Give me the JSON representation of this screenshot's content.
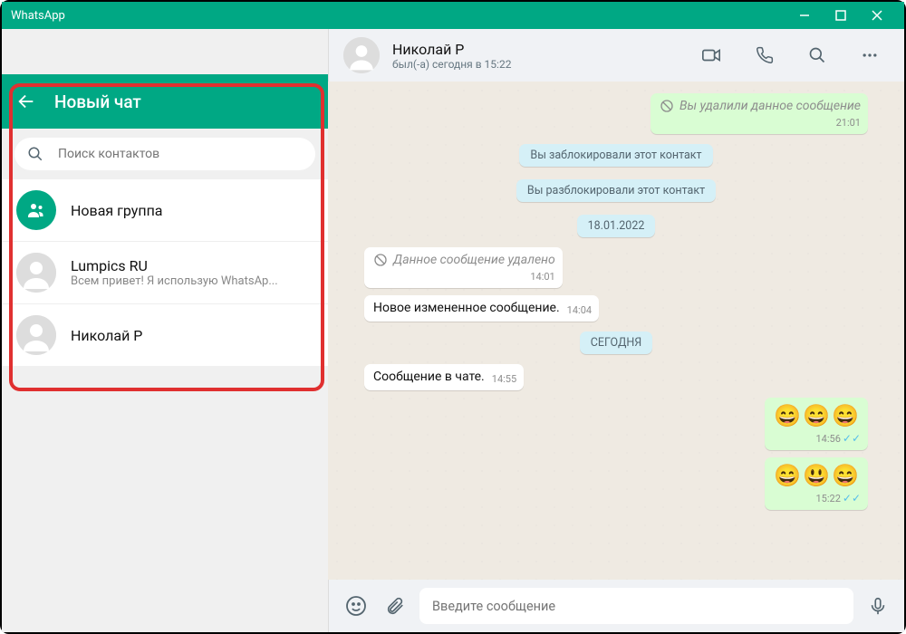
{
  "window": {
    "title": "WhatsApp"
  },
  "newChat": {
    "title": "Новый чат",
    "searchPlaceholder": "Поиск контактов",
    "newGroupLabel": "Новая группа",
    "contacts": [
      {
        "name": "Lumpics RU",
        "status": "Всем привет! Я использую WhatsAp..."
      },
      {
        "name": "Николай Р",
        "status": ""
      }
    ]
  },
  "chat": {
    "title": "Николай Р",
    "status": "был(-а) сегодня в 15:22",
    "composePlaceholder": "Введите сообщение",
    "messages": {
      "deletedOut": "Вы удалили данное сообщение",
      "deletedOutTime": "21:01",
      "sysBlocked": "Вы заблокировали этот контакт",
      "sysUnblocked": "Вы разблокировали этот контакт",
      "date1": "18.01.2022",
      "deletedIn": "Данное сообщение удалено",
      "deletedInTime": "14:01",
      "inEdited": "Новое измененное сообщение.",
      "inEditedTime": "14:04",
      "dateToday": "СЕГОДНЯ",
      "inChat": "Сообщение в чате.",
      "inChatTime": "14:55",
      "emoji1": "😄😄😄",
      "emoji1Time": "14:56",
      "emoji2": "😄😃😄",
      "emoji2Time": "15:22"
    }
  }
}
